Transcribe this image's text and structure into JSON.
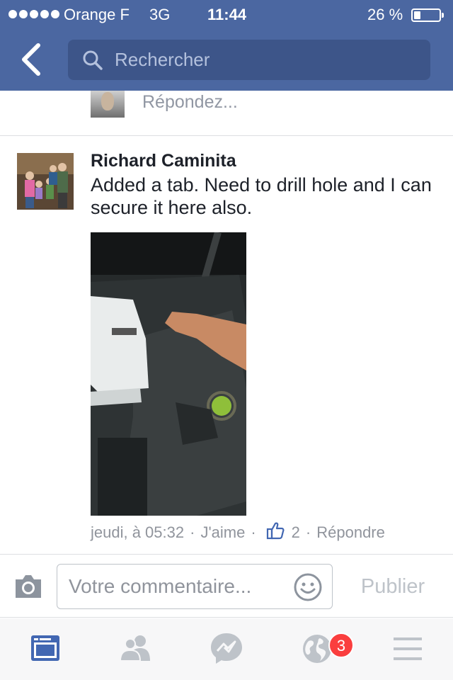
{
  "status_bar": {
    "carrier": "Orange F",
    "network": "3G",
    "time": "11:44",
    "battery": "26 %",
    "battery_level": 0.26
  },
  "header": {
    "search_placeholder": "Rechercher"
  },
  "reply_row": {
    "placeholder": "Répondez..."
  },
  "comment": {
    "author": "Richard Caminita",
    "text": "Added a tab.  Need to drill hole and I can secure it here also.",
    "timestamp": "jeudi, à 05:32",
    "separator": "·",
    "like_label": "J'aime",
    "like_count": "2",
    "reply_label": "Répondre"
  },
  "composer": {
    "placeholder": "Votre commentaire...",
    "publish_label": "Publier"
  },
  "tabbar": {
    "notifications_badge": "3"
  },
  "colors": {
    "header": "#4b67a1",
    "search_box": "#3d5589",
    "accent": "#4267b2",
    "badge": "#fa3e3e",
    "muted_text": "#90949c"
  }
}
